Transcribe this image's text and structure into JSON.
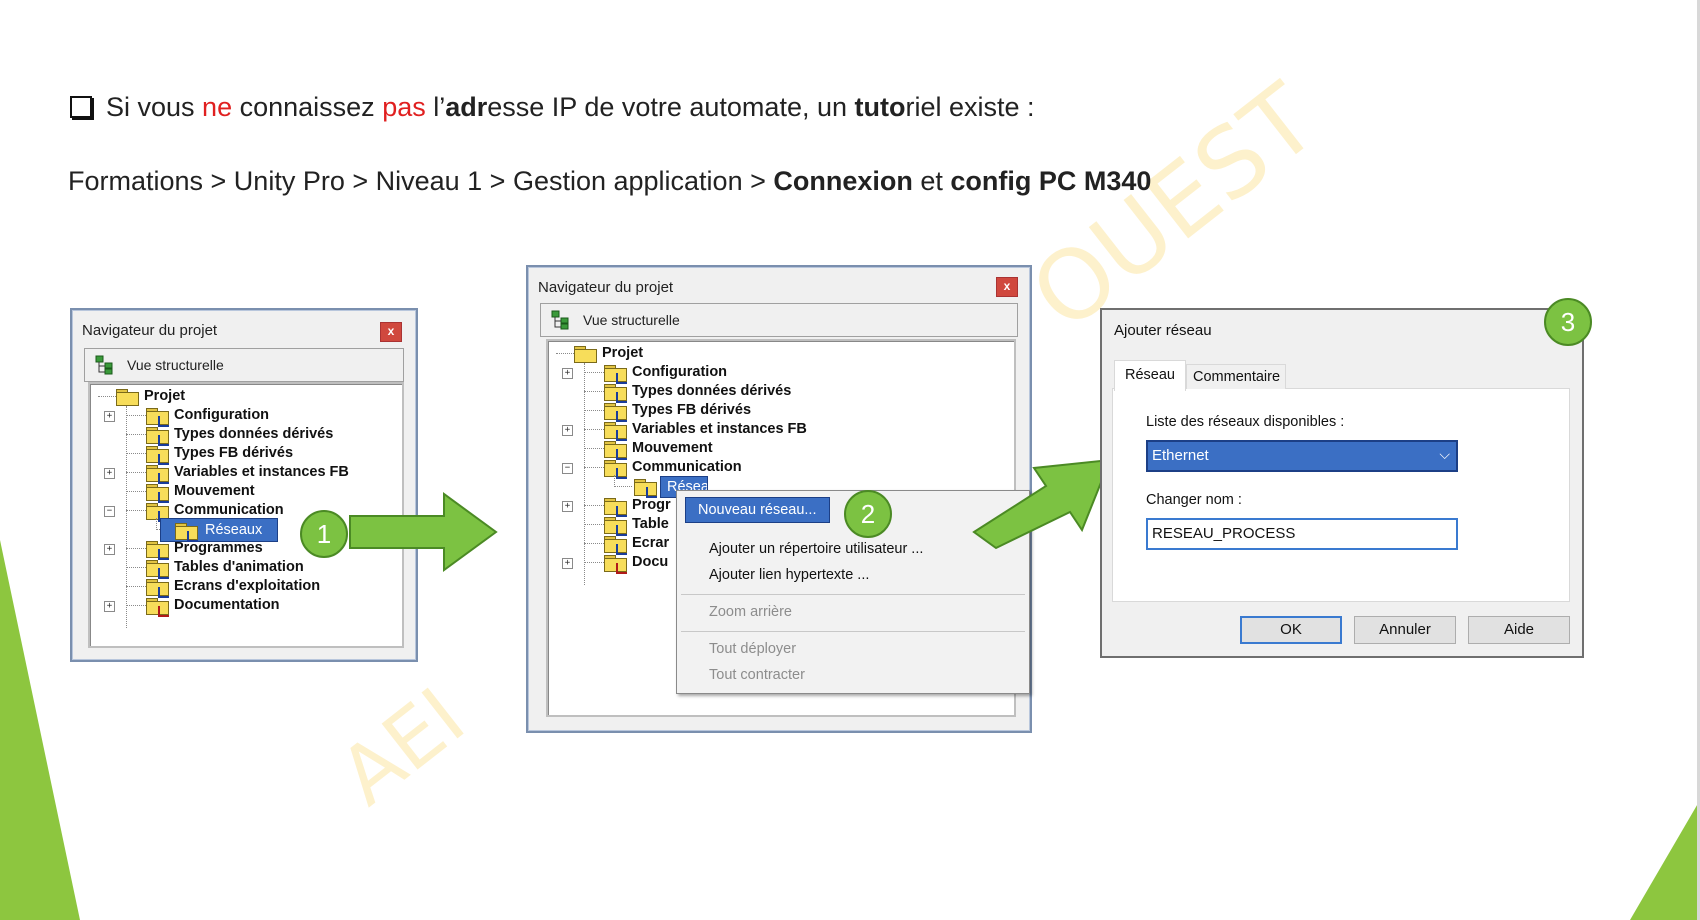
{
  "intro": {
    "text_a": "Si vous ",
    "text_ne": "ne",
    "text_b": " connaissez ",
    "text_pas": "pas",
    "text_c": " l’",
    "text_adr": "adr",
    "text_d": "esse IP de votre automate, un ",
    "text_tuto": "tuto",
    "text_e": "riel existe :"
  },
  "path": {
    "text_a": "Formations > Unity Pro > Niveau 1 > Gestion application > ",
    "text_connexion": "Connexion",
    "text_b": " et ",
    "text_config": "config PC M340"
  },
  "watermark": {
    "text_1": "OUEST",
    "text_2": "AEI"
  },
  "badges": {
    "one": "1",
    "two": "2",
    "three": "3"
  },
  "nav1": {
    "title": "Navigateur du projet",
    "close": "x",
    "view": "Vue structurelle",
    "tree": [
      "Projet",
      "Configuration",
      "Types données dérivés",
      "Types FB dérivés",
      "Variables et instances FB",
      "Mouvement",
      "Communication",
      "Réseaux",
      "Programmes",
      "Tables d'animation",
      "Ecrans d'exploitation",
      "Documentation"
    ]
  },
  "nav2": {
    "title": "Navigateur du projet",
    "close": "x",
    "view": "Vue structurelle",
    "tree": [
      "Projet",
      "Configuration",
      "Types données dérivés",
      "Types FB dérivés",
      "Variables et instances FB",
      "Mouvement",
      "Communication",
      "Réseaux",
      "Progr",
      "Table",
      "Ecrar",
      "Docu"
    ]
  },
  "context_menu": {
    "items": [
      "Nouveau réseau...",
      "Ajouter un répertoire utilisateur ...",
      "Ajouter lien hypertexte ...",
      "Zoom arrière",
      "Tout déployer",
      "Tout contracter"
    ]
  },
  "dialog": {
    "title": "Ajouter réseau",
    "tabs": [
      "Réseau",
      "Commentaire"
    ],
    "list_label": "Liste des réseaux disponibles :",
    "list_value": "Ethernet",
    "name_label": "Changer nom :",
    "name_value": "RESEAU_PROCESS",
    "ok": "OK",
    "cancel": "Annuler",
    "help": "Aide"
  },
  "colors": {
    "accent_green": "#7cc242",
    "selection_blue": "#3b6fc4",
    "emphasis_red": "#e02020"
  }
}
